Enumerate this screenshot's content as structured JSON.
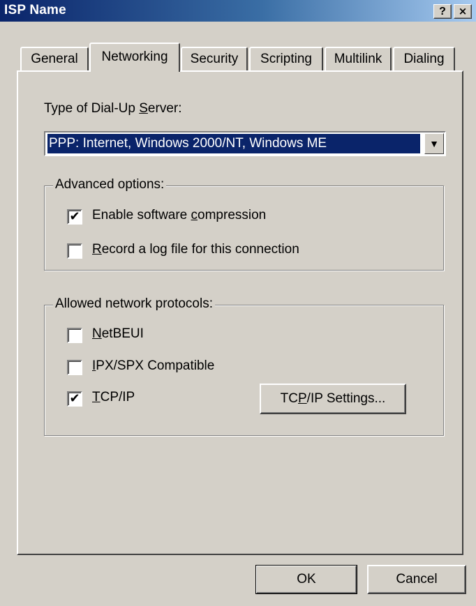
{
  "window": {
    "title": "ISP Name",
    "help_label": "?",
    "close_label": "×"
  },
  "tabs": [
    {
      "label": "General",
      "active": false
    },
    {
      "label": "Networking",
      "active": true
    },
    {
      "label": "Security",
      "active": false
    },
    {
      "label": "Scripting",
      "active": false
    },
    {
      "label": "Multilink",
      "active": false
    },
    {
      "label": "Dialing",
      "active": false
    }
  ],
  "server": {
    "label_pre": "Type of Dial-Up ",
    "label_key": "S",
    "label_post": "erver:",
    "selected": "PPP: Internet, Windows 2000/NT, Windows ME",
    "dropdown_icon": "chevron-down-icon"
  },
  "advanced": {
    "title": "Advanced options:",
    "compression": {
      "pre": "Enable software ",
      "key": "c",
      "post": "ompression",
      "checked": true,
      "mark": "✔"
    },
    "log": {
      "pre": "",
      "key": "R",
      "post": "ecord a log file for this connection",
      "checked": false,
      "mark": ""
    }
  },
  "protocols": {
    "title": "Allowed network protocols:",
    "netbeui": {
      "pre": "",
      "key": "N",
      "post": "etBEUI",
      "checked": false,
      "mark": ""
    },
    "ipx": {
      "pre": "",
      "key": "I",
      "post": "PX/SPX Compatible",
      "checked": false,
      "mark": ""
    },
    "tcpip": {
      "pre": "",
      "key": "T",
      "post": "CP/IP",
      "checked": true,
      "mark": "✔"
    },
    "settings_button": {
      "pre": "TC",
      "key": "P",
      "post": "/IP Settings..."
    }
  },
  "footer": {
    "ok_label": "OK",
    "cancel_label": "Cancel"
  }
}
